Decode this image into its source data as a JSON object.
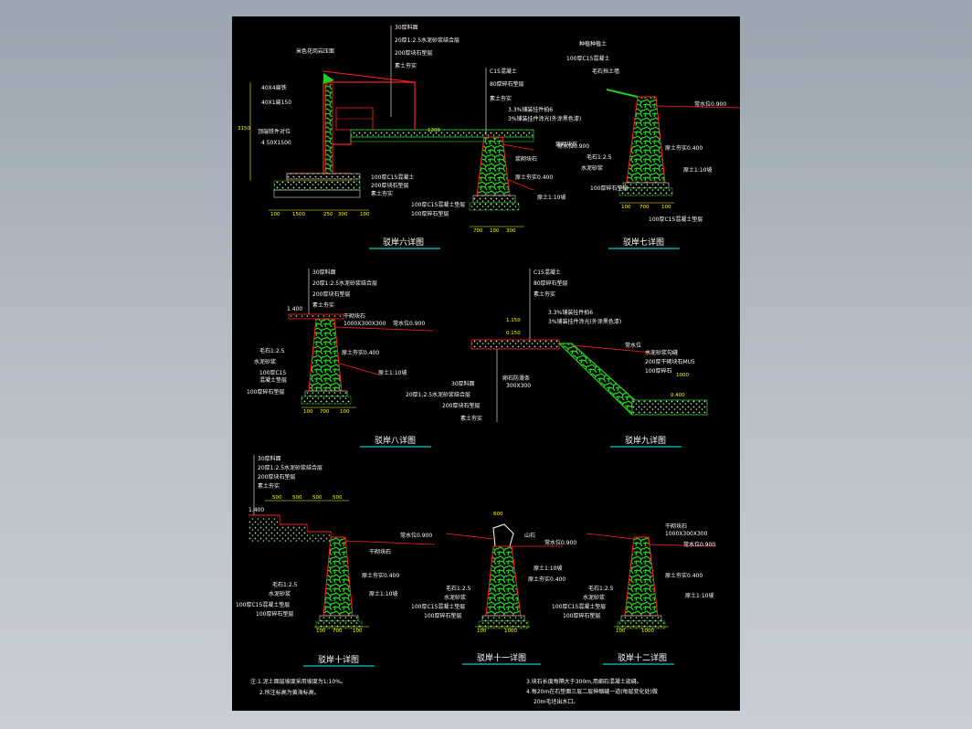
{
  "colors": {
    "background": "#000000",
    "text": "#ffffff",
    "line": "#ff2020",
    "fill": "#22cc22",
    "dim": "#ffff00",
    "underline": "#00ffff"
  },
  "titles": {
    "d6": "驳岸六详图",
    "d7": "驳岸七详图",
    "d8": "驳岸八详图",
    "d9": "驳岸九详图",
    "d10": "驳岸十详图",
    "d11": "驳岸十一详图",
    "d12": "驳岸十二详图"
  },
  "d6": {
    "layers": [
      "30厚料面",
      "20厚1:2.5水泥砂浆结合层",
      "200厚块石垫层",
      "素土夯实"
    ],
    "left": [
      "米色花岗岩压面",
      "40X4扁铁",
      "40X1扁150",
      "顶端铁件对位",
      "4  50X1500"
    ],
    "mid": [
      "C15混凝土",
      "80厚碎石垫层",
      "素土夯实",
      "3.3%铺装挂件拍6",
      "3%铺装挂件涂光(外涂黑色漆)"
    ],
    "lower": [
      "100厚C15混凝土",
      "200厚块石垫层",
      "素土夯实",
      "100厚C15混凝土垫层",
      "100厚碎石垫层"
    ],
    "right": [
      "常水位0.900",
      "浆砌块石",
      "原土夯实0.400",
      "原土1:10坡"
    ],
    "dims": [
      "100",
      "1500",
      "250",
      "300",
      "100",
      "1200",
      "300",
      "100",
      "700",
      "100",
      "3150",
      "500"
    ]
  },
  "d7": {
    "labels": [
      "种植种植土",
      "100厚C15混凝土",
      "毛石挡土墙",
      "常水位0.900",
      "浆砌块石",
      "原土夯实0.400",
      "毛石1:2.5",
      "水泥砂浆",
      "100厚碎石垫层",
      "原土1:10坡",
      "100厚C15混凝土垫层"
    ],
    "dims": [
      "100",
      "700",
      "100"
    ]
  },
  "d8": {
    "layers": [
      "30厚料面",
      "20厚1:2.5水泥砂浆结合层",
      "200厚块石垫层",
      "素土夯实"
    ],
    "labels": [
      "1.400",
      "干砌块石",
      "1000X300X300",
      "常水位0.900",
      "原土夯实0.400",
      "毛石1:2.5",
      "水泥砂浆",
      "100厚C15",
      "混凝土垫层",
      "100厚碎石垫层",
      "原土1:10坡"
    ],
    "dims": [
      "100",
      "700",
      "100"
    ]
  },
  "d9": {
    "layers": [
      "C15混凝土",
      "80厚碎石垫层",
      "素土夯实"
    ],
    "labels": [
      "3.3%铺装挂件拍6",
      "3%铺装挂件涂光(外涂黑色漆)",
      "1.150",
      "0.150",
      "常水位",
      "水泥砂浆勾缝",
      "200厚干砌块石MU5",
      "100厚碎石",
      "1000",
      "0.400",
      "30厚料面",
      "20厚1:2.5水泥砂浆结合层",
      "200厚块石垫层",
      "素土夯实",
      "卵石防滑条",
      "300X300"
    ]
  },
  "d10": {
    "layers": [
      "30厚料面",
      "20厚1:2.5水泥砂浆结合层",
      "200厚块石垫层",
      "素土夯实"
    ],
    "labels": [
      "1.400",
      "常水位0.900",
      "干砌块石",
      "原土夯实0.400",
      "毛石1:2.5",
      "水泥砂浆",
      "100厚C15混凝土垫层",
      "100厚碎石垫层",
      "原土1:10坡"
    ],
    "dims": [
      "500",
      "500",
      "500",
      "500",
      "100",
      "700",
      "100"
    ]
  },
  "d11": {
    "labels": [
      "600",
      "山石",
      "常水位0.900",
      "原土1:10坡",
      "原土夯实0.400",
      "毛石1:2.5",
      "水泥砂浆",
      "100厚C15混凝土垫层",
      "100厚碎石垫层"
    ],
    "dims": [
      "100",
      "1000"
    ]
  },
  "d12": {
    "labels": [
      "干砌块石",
      "1000X300X300",
      "常水位0.900",
      "原土夯实0.400",
      "毛石1:2.5",
      "水泥砂浆",
      "100厚C15混凝土垫层",
      "100厚碎石垫层",
      "原土1:10坡"
    ],
    "dims": [
      "100",
      "1000"
    ]
  },
  "notes": {
    "left1": "注:1.泥土面层坡度采用坡度为1:10%。",
    "left2": "2.所注标高为黄海标高。",
    "right1": "3.块石长度每隔大于300m,用细石混凝土嵌缝。",
    "right2": "4.每20m在石垫面三层二层伸缩缝一道(每层变化处)做",
    "right3": "20m毛坯出水口。"
  }
}
